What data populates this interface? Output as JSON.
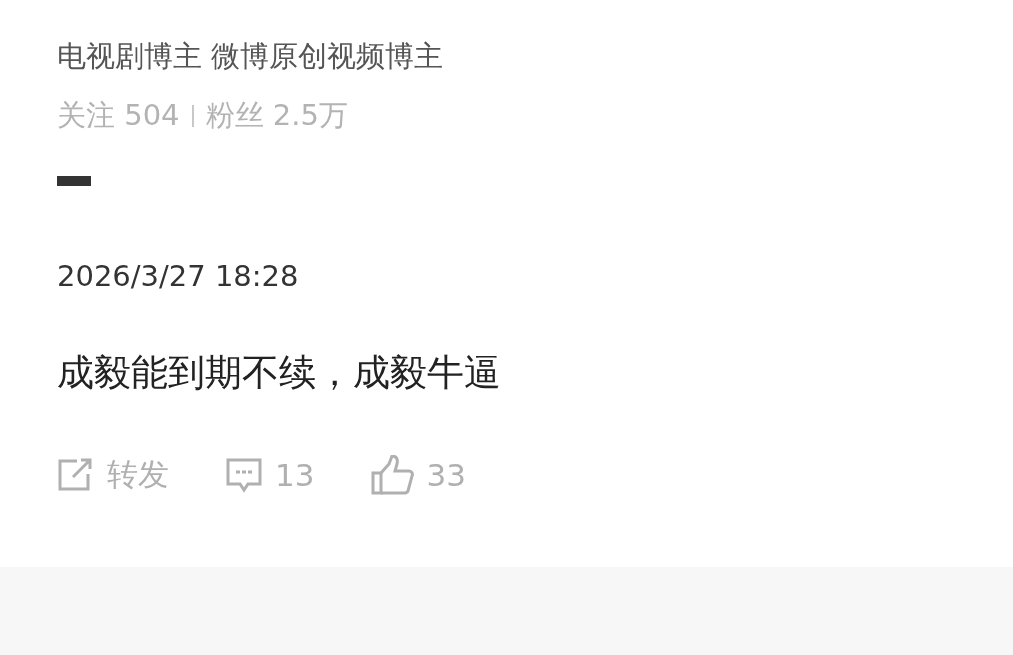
{
  "profile": {
    "bio": "电视剧博主 微博原创视频博主",
    "stats": [
      {
        "label": "关注",
        "value": "504"
      },
      {
        "label": "粉丝",
        "value": "2.5万"
      }
    ]
  },
  "post": {
    "time": "2026/3/27 18:28",
    "text": "成毅能到期不续，成毅牛逼"
  },
  "actions": [
    {
      "kind": "repost",
      "label": "转发"
    },
    {
      "kind": "comment",
      "label": "13"
    },
    {
      "kind": "like",
      "label": "33"
    }
  ]
}
